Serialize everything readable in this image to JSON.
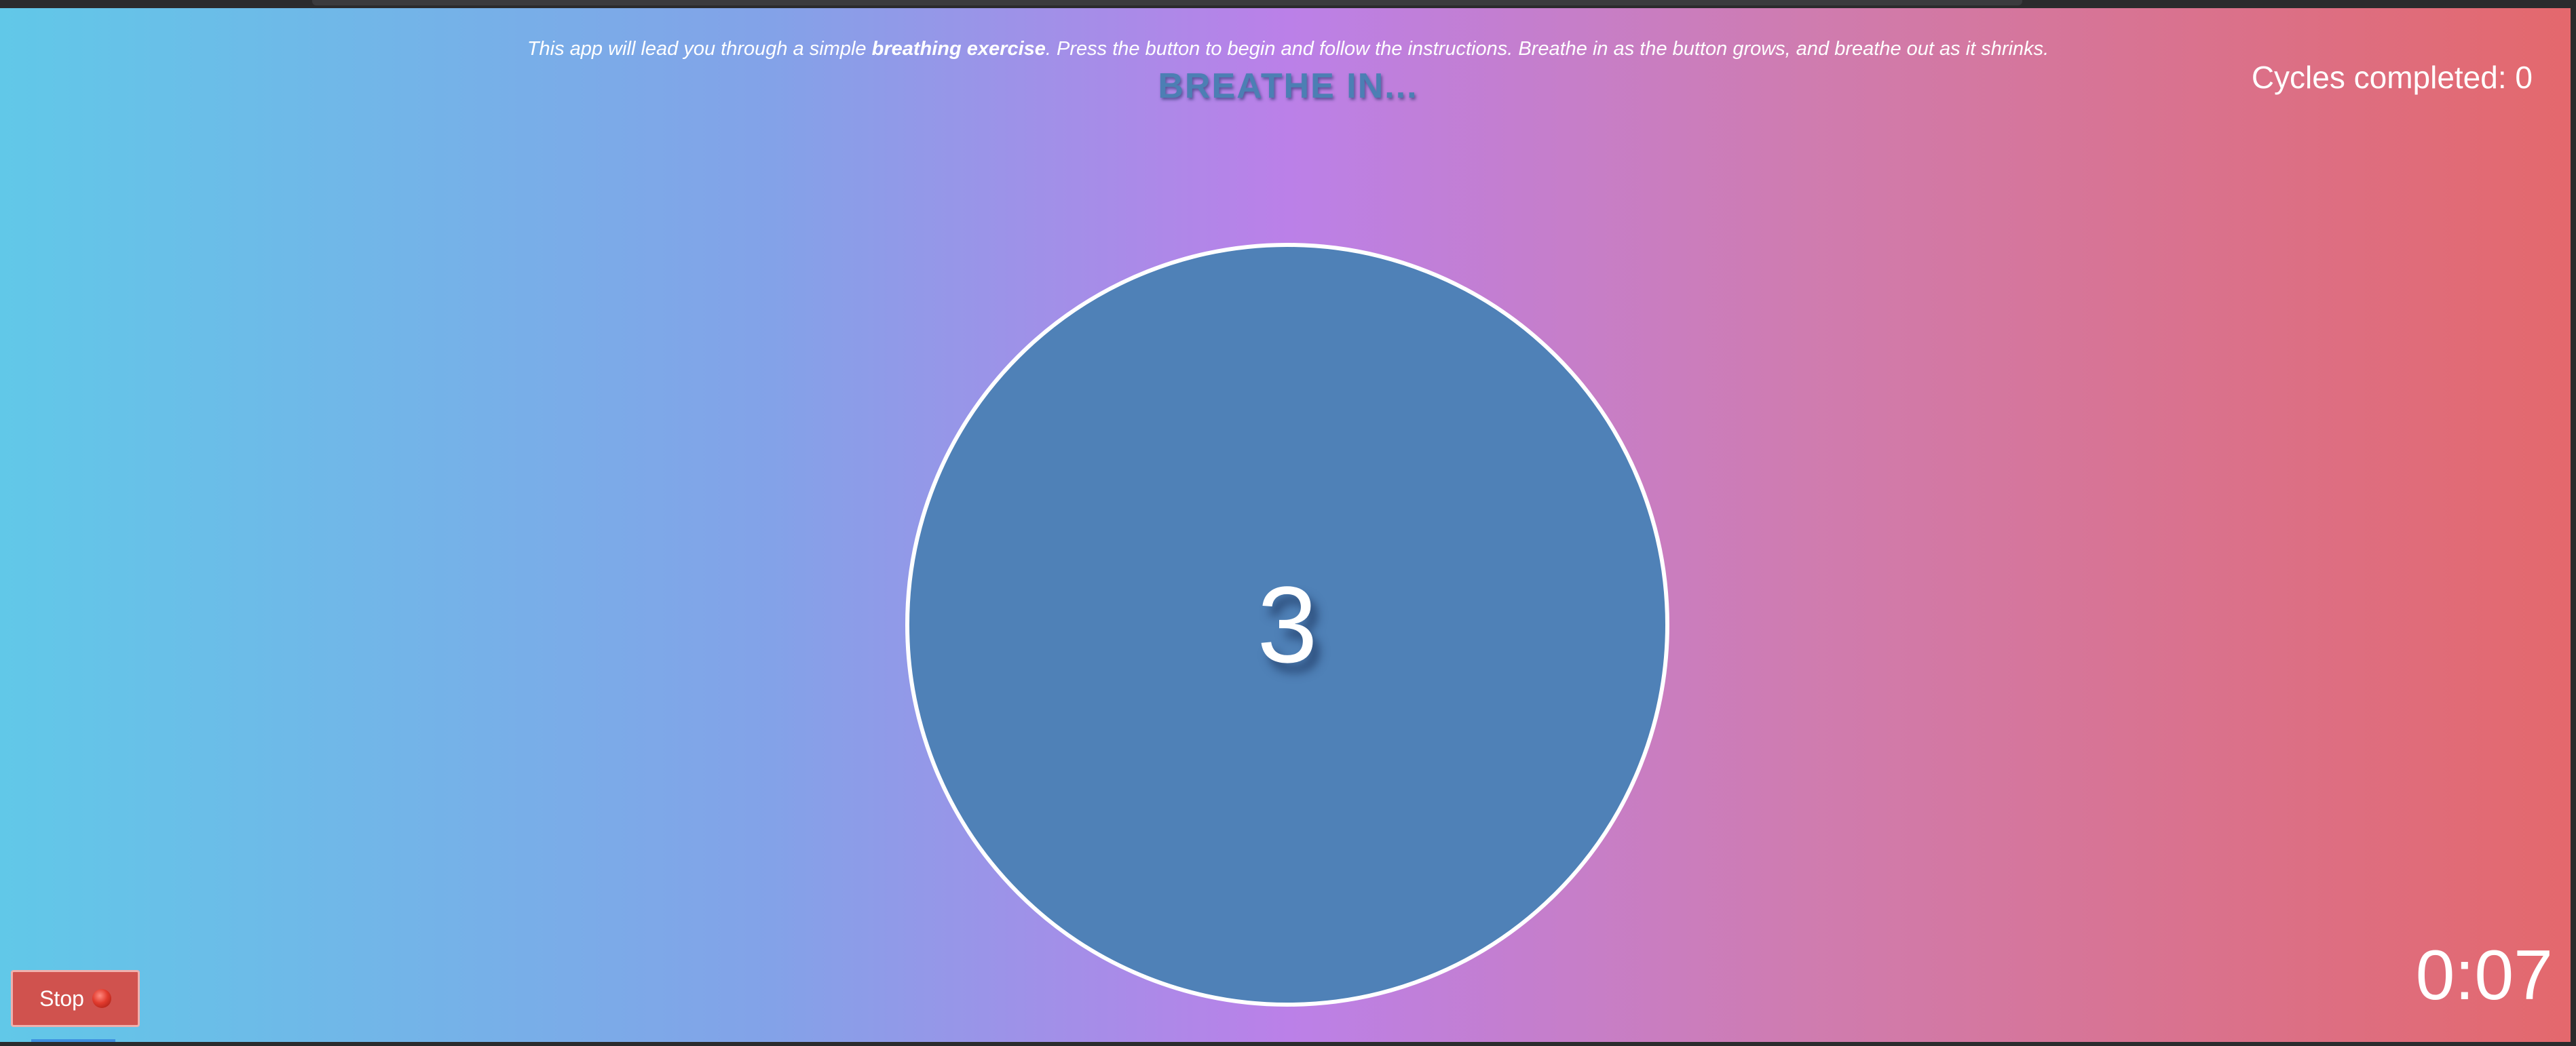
{
  "intro": {
    "text_before": "This app will lead you through a simple ",
    "text_bold": "breathing exercise",
    "text_after": ". Press the button to begin and follow the instructions. Breathe in as the button grows, and breathe out as it shrinks."
  },
  "instruction": "BREATHE IN...",
  "cycles": {
    "label": "Cycles completed: 0"
  },
  "circle": {
    "countdown": "3",
    "color": "#4f81b7"
  },
  "stop_button": {
    "label": "Stop",
    "icon": "red-circle-icon"
  },
  "timer": "0:07",
  "colors": {
    "gradient_left": "#61c8e8",
    "gradient_mid": "#bb80e8",
    "gradient_right": "#e4686c",
    "stop_button": "#d0524e",
    "heading": "#4c7fb4"
  }
}
